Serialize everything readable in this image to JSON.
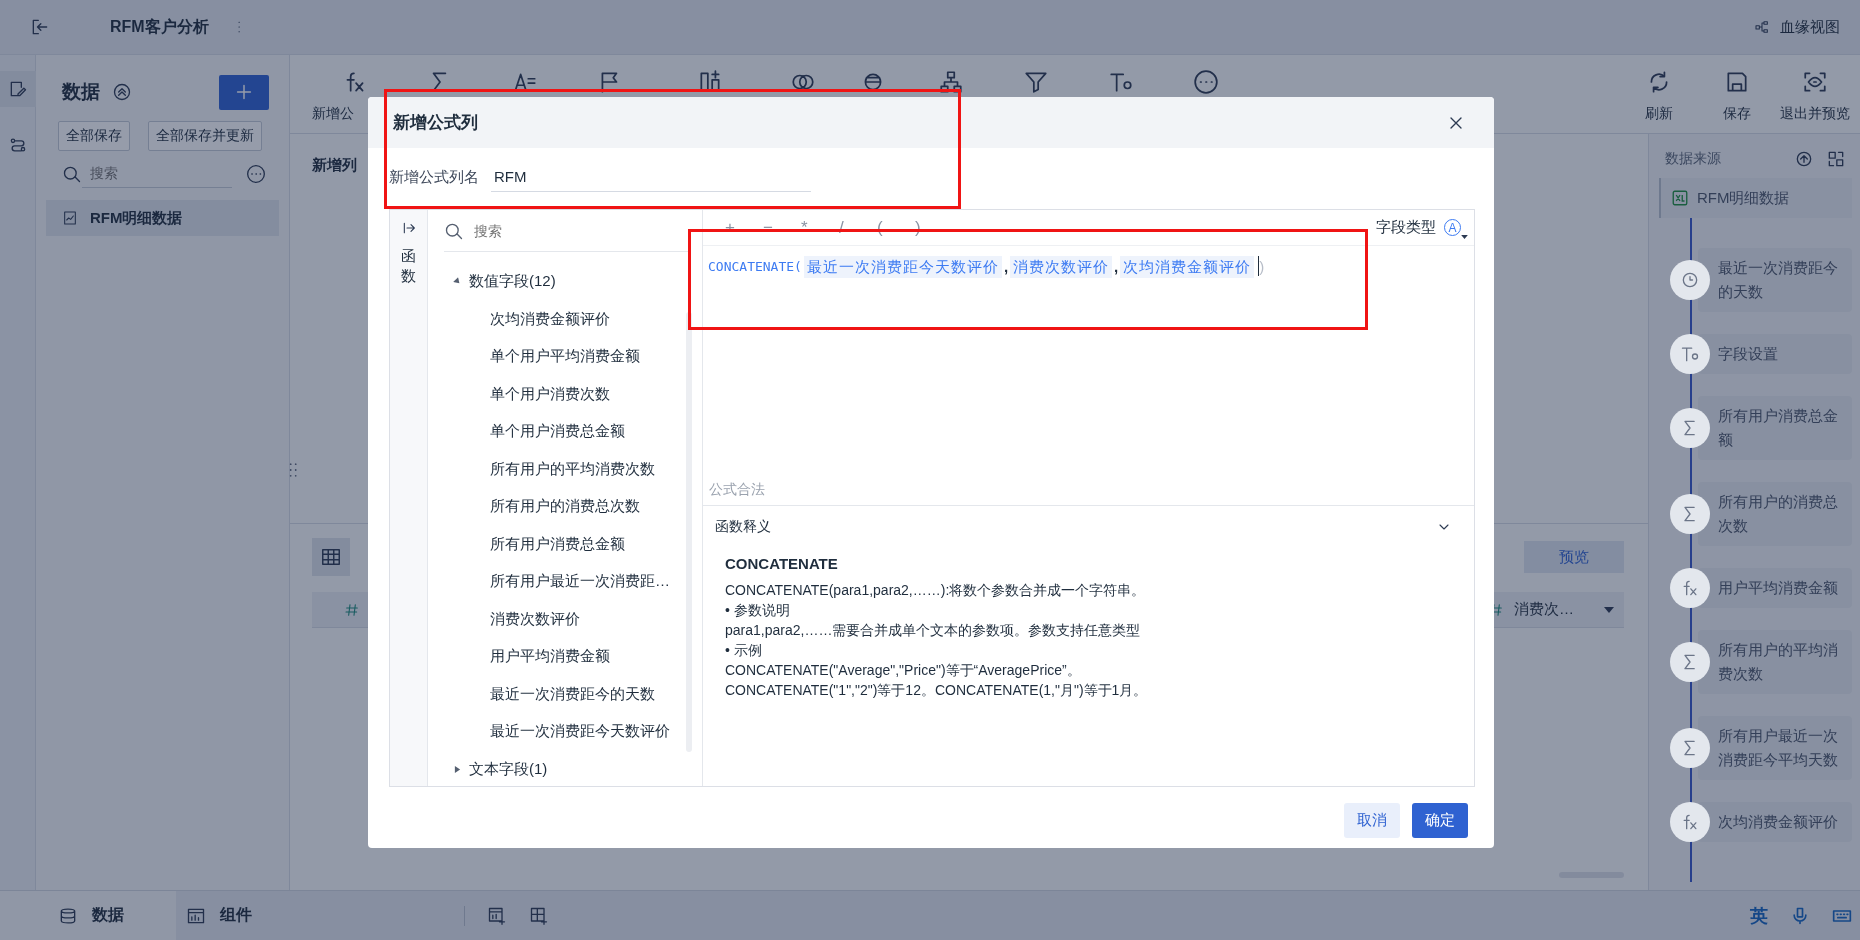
{
  "topbar": {
    "title": "RFM客户分析",
    "lineage": "血缘视图"
  },
  "left_panel": {
    "title": "数据",
    "buttons": [
      "全部保存",
      "全部保存并更新"
    ],
    "search": {
      "placeholder": "搜索"
    },
    "items": [
      {
        "label": "RFM明细数据",
        "selected": true
      }
    ]
  },
  "toolbar": {
    "items": [
      {
        "kind": "fx",
        "label": "新增公"
      },
      {
        "kind": "sum"
      },
      {
        "kind": "text"
      },
      {
        "kind": "flag"
      },
      {
        "kind": "columns"
      },
      {
        "kind": "merge"
      },
      {
        "kind": "layers"
      },
      {
        "kind": "tree"
      },
      {
        "kind": "filter"
      },
      {
        "kind": "field"
      },
      {
        "kind": "more"
      }
    ],
    "actions": [
      {
        "kind": "refresh",
        "label": "刷新"
      },
      {
        "kind": "save",
        "label": "保存"
      },
      {
        "kind": "preview",
        "label": "退出并预览"
      }
    ]
  },
  "main": {
    "section_title": "新增列",
    "preview_button": "预览",
    "column_header": "消费次…"
  },
  "right_panel": {
    "title": "数据来源",
    "source": "RFM明细数据",
    "steps": [
      {
        "kind": "clock",
        "label": "最近一次消费距今的天数"
      },
      {
        "kind": "field",
        "label": "字段设置"
      },
      {
        "kind": "sum",
        "label": "所有用户消费总金额"
      },
      {
        "kind": "sum",
        "label": "所有用户的消费总次数"
      },
      {
        "kind": "fx",
        "label": "用户平均消费金额"
      },
      {
        "kind": "sum",
        "label": "所有用户的平均消费次数"
      },
      {
        "kind": "sum",
        "label": "所有用户最近一次消费距今平均天数"
      },
      {
        "kind": "fx",
        "label": "次均消费金额评价"
      }
    ]
  },
  "bottom_tabs": [
    {
      "label": "数据",
      "kind": "database",
      "selected": true
    },
    {
      "label": "组件",
      "kind": "chart",
      "selected": false
    }
  ],
  "ime": {
    "label": "英"
  },
  "dialog": {
    "title": "新增公式列",
    "name_field": {
      "label": "新增公式列名",
      "value": "RFM"
    },
    "side_tab": "函数",
    "field_search": {
      "placeholder": "搜索"
    },
    "field_tree": [
      {
        "label": "数值字段(12)",
        "expanded": true,
        "children": [
          {
            "label": "次均消费金额评价"
          },
          {
            "label": "单个用户平均消费金额"
          },
          {
            "label": "单个用户消费次数"
          },
          {
            "label": "单个用户消费总金额"
          },
          {
            "label": "所有用户的平均消费次数"
          },
          {
            "label": "所有用户的消费总次数"
          },
          {
            "label": "所有用户消费总金额"
          },
          {
            "label": "所有用户最近一次消费距…"
          },
          {
            "label": "消费次数评价"
          },
          {
            "label": "用户平均消费金额"
          },
          {
            "label": "最近一次消费距今的天数"
          },
          {
            "label": "最近一次消费距今天数评价"
          }
        ]
      },
      {
        "label": "文本字段(1)",
        "expanded": false
      }
    ],
    "operators": [
      "+",
      "−",
      "*",
      "/",
      "(",
      ")"
    ],
    "field_type_label": "字段类型",
    "field_type_icon": "A",
    "formula": [
      {
        "kind": "function",
        "text": "CONCATENATE("
      },
      {
        "kind": "field",
        "text": "最近一次消费距今天数评价"
      },
      {
        "kind": "comma",
        "text": ","
      },
      {
        "kind": "field",
        "text": "消费次数评价"
      },
      {
        "kind": "comma",
        "text": ","
      },
      {
        "kind": "field",
        "text": "次均消费金额评价"
      },
      {
        "kind": "cursor"
      },
      {
        "kind": "close",
        "text": ")"
      }
    ],
    "status": "公式合法",
    "help": {
      "title": "函数释义",
      "expanded": true,
      "function": "CONCATENATE",
      "lines": [
        "CONCATENATE(para1,para2,……):将数个参数合并成一个字符串。",
        "• 参数说明",
        "para1,para2,……需要合并成单个文本的参数项。参数支持任意类型",
        "• 示例",
        "CONCATENATE(\"Average\",\"Price\")等于“AveragePrice”。",
        "CONCATENATE(\"1\",\"2\")等于12。CONCATENATE(1,\"月\")等于1月。"
      ]
    },
    "buttons": [
      {
        "kind": "secondary",
        "label": "取消"
      },
      {
        "kind": "primary",
        "label": "确定"
      }
    ]
  }
}
